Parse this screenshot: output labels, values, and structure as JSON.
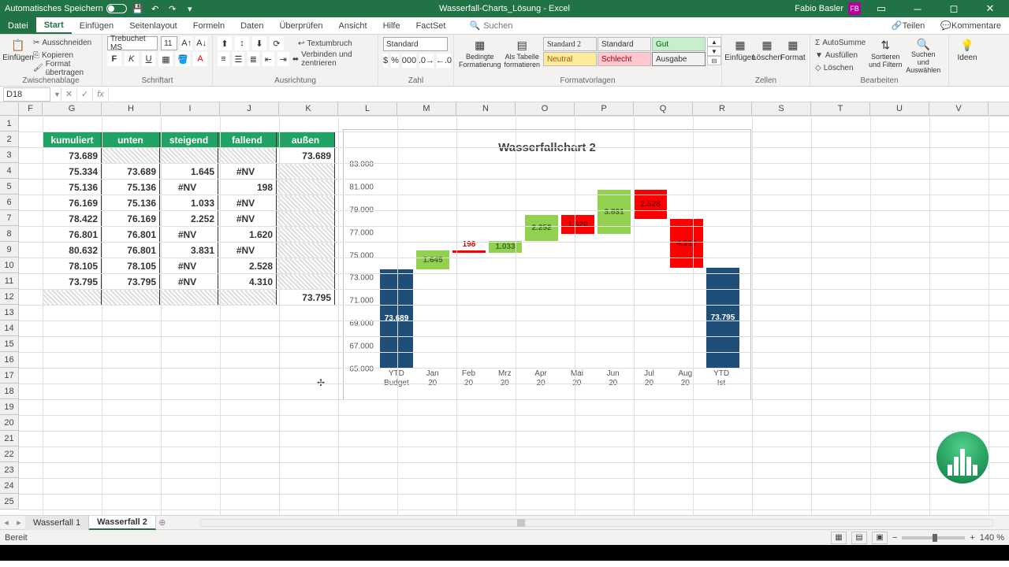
{
  "titlebar": {
    "autosave_label": "Automatisches Speichern",
    "doc_title": "Wasserfall-Charts_Lösung - Excel",
    "user_name": "Fabio Basler",
    "user_initials": "FB"
  },
  "menu": {
    "file": "Datei",
    "start": "Start",
    "einfuegen": "Einfügen",
    "seitenlayout": "Seitenlayout",
    "formeln": "Formeln",
    "daten": "Daten",
    "ueberpruefen": "Überprüfen",
    "ansicht": "Ansicht",
    "hilfe": "Hilfe",
    "factset": "FactSet",
    "suchen_placeholder": "Suchen",
    "teilen": "Teilen",
    "kommentare": "Kommentare"
  },
  "ribbon": {
    "einfuegen": "Einfügen",
    "ausschneiden": "Ausschneiden",
    "kopieren": "Kopieren",
    "format_uebertragen": "Format übertragen",
    "g_zwischenablage": "Zwischenablage",
    "font_name": "Trebuchet MS",
    "font_size": "11",
    "g_schriftart": "Schriftart",
    "textumbruch": "Textumbruch",
    "verbinden": "Verbinden und zentrieren",
    "g_ausrichtung": "Ausrichtung",
    "numfmt": "Standard",
    "g_zahl": "Zahl",
    "bedingte": "Bedingte Formatierung",
    "als_tabelle": "Als Tabelle formatieren",
    "style_std2": "Standard 2",
    "style_std": "Standard",
    "style_gut": "Gut",
    "style_neutral": "Neutral",
    "style_schlecht": "Schlecht",
    "style_ausgabe": "Ausgabe",
    "g_formatvorlagen": "Formatvorlagen",
    "zellen_einfuegen": "Einfügen",
    "loeschen": "Löschen",
    "format": "Format",
    "g_zellen": "Zellen",
    "autosumme": "AutoSumme",
    "ausfuellen": "Ausfüllen",
    "loeschen2": "Löschen",
    "sortieren": "Sortieren und Filtern",
    "suchen": "Suchen und Auswählen",
    "g_bearbeiten": "Bearbeiten",
    "ideen": "Ideen"
  },
  "namebox": "D18",
  "columns": [
    "F",
    "G",
    "H",
    "I",
    "J",
    "K",
    "L",
    "M",
    "N",
    "O",
    "P",
    "Q",
    "R",
    "S",
    "T",
    "U",
    "V"
  ],
  "rows_visible": 25,
  "table": {
    "headers": [
      "kumuliert",
      "unten",
      "steigend",
      "fallend",
      "außen"
    ],
    "rows": [
      [
        "73.689",
        "",
        "",
        "",
        "73.689"
      ],
      [
        "75.334",
        "73.689",
        "1.645",
        "#NV",
        ""
      ],
      [
        "75.136",
        "75.136",
        "#NV",
        "198",
        ""
      ],
      [
        "76.169",
        "75.136",
        "1.033",
        "#NV",
        ""
      ],
      [
        "78.422",
        "76.169",
        "2.252",
        "#NV",
        ""
      ],
      [
        "76.801",
        "76.801",
        "#NV",
        "1.620",
        ""
      ],
      [
        "80.632",
        "76.801",
        "3.831",
        "#NV",
        ""
      ],
      [
        "78.105",
        "78.105",
        "#NV",
        "2.528",
        ""
      ],
      [
        "73.795",
        "73.795",
        "#NV",
        "4.310",
        ""
      ],
      [
        "",
        "",
        "",
        "",
        "73.795"
      ]
    ],
    "hatch": [
      [
        false,
        true,
        true,
        true,
        false
      ],
      [
        false,
        false,
        false,
        false,
        true
      ],
      [
        false,
        false,
        false,
        false,
        true
      ],
      [
        false,
        false,
        false,
        false,
        true
      ],
      [
        false,
        false,
        false,
        false,
        true
      ],
      [
        false,
        false,
        false,
        false,
        true
      ],
      [
        false,
        false,
        false,
        false,
        true
      ],
      [
        false,
        false,
        false,
        false,
        true
      ],
      [
        false,
        false,
        false,
        false,
        true
      ],
      [
        true,
        true,
        true,
        true,
        false
      ]
    ]
  },
  "chart_data": {
    "type": "bar",
    "title": "Wasserfallchart 2",
    "categories": [
      "YTD Budget",
      "Jan 20",
      "Feb 20",
      "Mrz 20",
      "Apr 20",
      "Mai 20",
      "Jun 20",
      "Jul 20",
      "Aug 20",
      "YTD Ist"
    ],
    "ylim": [
      65000,
      83000
    ],
    "yticks": [
      "65.000",
      "67.000",
      "69.000",
      "71.000",
      "73.000",
      "75.000",
      "77.000",
      "79.000",
      "81.000",
      "83.000"
    ],
    "series": [
      {
        "name": "unten",
        "color": "transparent",
        "values": [
          0,
          73689,
          75136,
          75136,
          76169,
          76801,
          76801,
          78105,
          73795,
          0
        ]
      },
      {
        "name": "außen",
        "color": "#1f4e78",
        "values": [
          73689,
          0,
          0,
          0,
          0,
          0,
          0,
          0,
          0,
          73795
        ],
        "labels": [
          "73.689",
          "",
          "",
          "",
          "",
          "",
          "",
          "",
          "",
          "73.795"
        ]
      },
      {
        "name": "steigend",
        "color": "#92d050",
        "values": [
          0,
          1645,
          0,
          1033,
          2252,
          0,
          3831,
          0,
          0,
          0
        ],
        "labels": [
          "",
          "1.645",
          "",
          "1.033",
          "2.252",
          "",
          "3.831",
          "",
          "",
          ""
        ]
      },
      {
        "name": "fallend",
        "color": "#ff0000",
        "values": [
          0,
          0,
          198,
          0,
          0,
          1620,
          0,
          2528,
          4310,
          0
        ],
        "labels": [
          "",
          "",
          "198",
          "",
          "",
          "1.620",
          "",
          "2.528",
          "4.310",
          ""
        ]
      }
    ],
    "bar_labels": [
      "73.689",
      "1.645",
      "198",
      "1.033",
      "2.252",
      "1.620",
      "3.831",
      "2.528",
      "4.310",
      "73.795"
    ]
  },
  "sheets": {
    "tab1": "Wasserfall 1",
    "tab2": "Wasserfall 2"
  },
  "status": {
    "bereit": "Bereit",
    "zoom": "140 %"
  }
}
